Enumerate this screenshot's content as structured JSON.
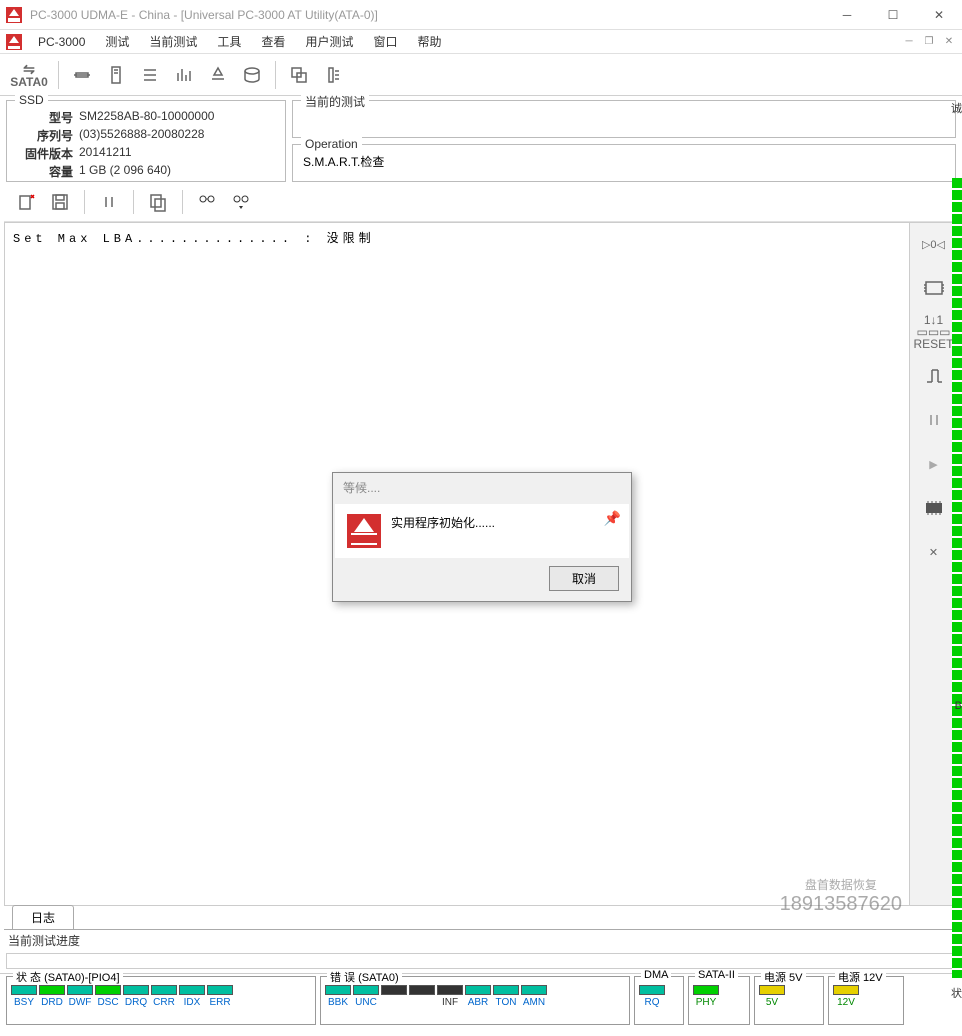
{
  "window": {
    "title": "PC-3000 UDMA-E - China - [Universal PC-3000 AT Utility(ATA-0)]"
  },
  "menu": {
    "app": "PC-3000",
    "items": [
      "测试",
      "当前测试",
      "工具",
      "查看",
      "用户测试",
      "窗口",
      "帮助"
    ]
  },
  "toolbar": {
    "port": "SATA0"
  },
  "ssd": {
    "title": "SSD",
    "model_label": "型号",
    "model": "SM2258AB-80-10000000",
    "serial_label": "序列号",
    "serial": "(03)5526888-20080228",
    "firmware_label": "固件版本",
    "firmware": "20141211",
    "capacity_label": "容量",
    "capacity": "1 GB (2 096 640)"
  },
  "current_test": {
    "title": "当前的测试"
  },
  "operation": {
    "title": "Operation",
    "text": "S.M.A.R.T.检查"
  },
  "log": {
    "text": "Set Max LBA.............. : 没限制"
  },
  "right_rail": {
    "reset": "RESET"
  },
  "tabs": {
    "log": "日志"
  },
  "progress": {
    "label": "当前测试进度"
  },
  "dialog": {
    "title": "等候....",
    "message": "实用程序初始化......",
    "cancel": "取消"
  },
  "status": {
    "group1_title": "状 态 (SATA0)-[PIO4]",
    "group1": [
      "BSY",
      "DRD",
      "DWF",
      "DSC",
      "DRQ",
      "CRR",
      "IDX",
      "ERR"
    ],
    "group2_title": "错 误 (SATA0)",
    "group2": [
      "BBK",
      "UNC",
      "",
      "",
      "INF",
      "ABR",
      "TON",
      "AMN"
    ],
    "group3_title": "DMA",
    "group3": [
      "RQ"
    ],
    "group4_title": "SATA-II",
    "group4": [
      "PHY"
    ],
    "group5_title": "电源 5V",
    "group5": [
      "5V"
    ],
    "group6_title": "电源 12V",
    "group6": [
      "12V"
    ]
  },
  "watermark": {
    "text": "盘首数据恢复",
    "phone": "18913587620"
  }
}
